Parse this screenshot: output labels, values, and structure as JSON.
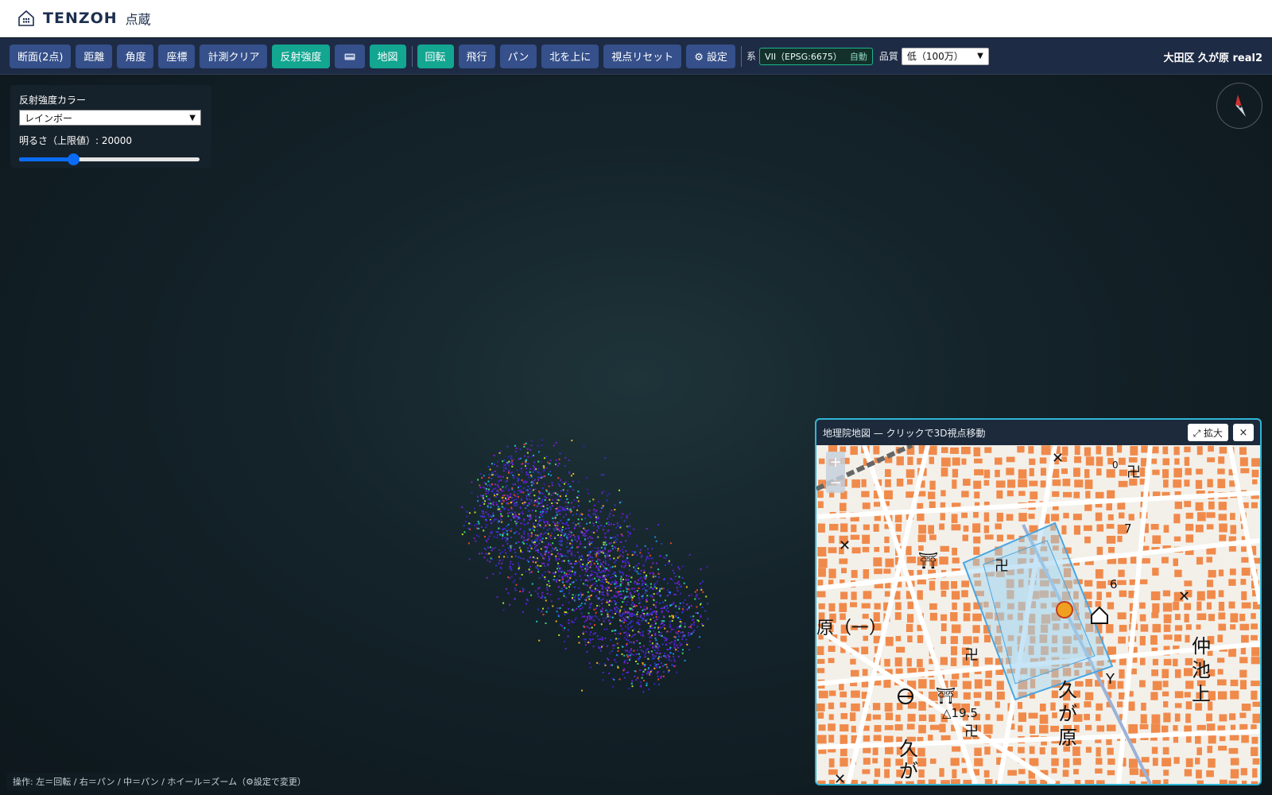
{
  "header": {
    "brand": "TENZOH",
    "brand_sub": "点蔵",
    "logo_icon": "house-grid-icon"
  },
  "toolbar": {
    "buttons": [
      {
        "label": "断面(2点)",
        "active": false
      },
      {
        "label": "距離",
        "active": false
      },
      {
        "label": "角度",
        "active": false
      },
      {
        "label": "座標",
        "active": false
      },
      {
        "label": "計測クリア",
        "active": false
      },
      {
        "label": "反射強度",
        "active": true
      },
      {
        "label": "▬",
        "active": false,
        "icon": "camera-icon"
      },
      {
        "label": "地図",
        "active": true
      }
    ],
    "buttons2": [
      {
        "label": "回転",
        "active": true
      },
      {
        "label": "飛行",
        "active": false
      },
      {
        "label": "パン",
        "active": false
      },
      {
        "label": "北を上に",
        "active": false
      },
      {
        "label": "視点リセット",
        "active": false
      },
      {
        "label": "⚙ 設定",
        "active": false
      }
    ],
    "crs_label": "系",
    "crs_value": "VII（EPSG:6675）",
    "crs_auto": "自動",
    "quality_label": "品質",
    "quality_value": "低（100万）",
    "location_title": "大田区 久が原 real2"
  },
  "intensity_panel": {
    "color_label": "反射強度カラー",
    "color_value": "レインボー",
    "brightness_label": "明るさ（上限値）: 20000",
    "brightness_fraction": 0.3
  },
  "hint": "操作: 左＝回転 / 右＝パン / 中＝パン / ホイール＝ズーム（⚙設定で変更）",
  "map": {
    "title": "地理院地図 — クリックで3D視点移動",
    "expand_label": "⤢ 拡大",
    "close_label": "×",
    "zoom_in": "+",
    "zoom_out": "−",
    "labels": {
      "spot_height": "△19.5",
      "num6": "6",
      "num7": "7",
      "num0": "0",
      "paren": "原（一）",
      "kugahara": "久が原",
      "kuga_small": "久が",
      "nakaike": "仲池上",
      "paren2": "（一）"
    },
    "colors": {
      "building": "#f08a4b",
      "road": "#ffffff",
      "boundary": "#4aa6e0",
      "marker": "#f0a020"
    }
  },
  "colors": {
    "toolbar_bg": "#1e2b45",
    "button_blue": "#35508a",
    "button_teal": "#13a691",
    "accent_border": "#2fb6d6"
  }
}
